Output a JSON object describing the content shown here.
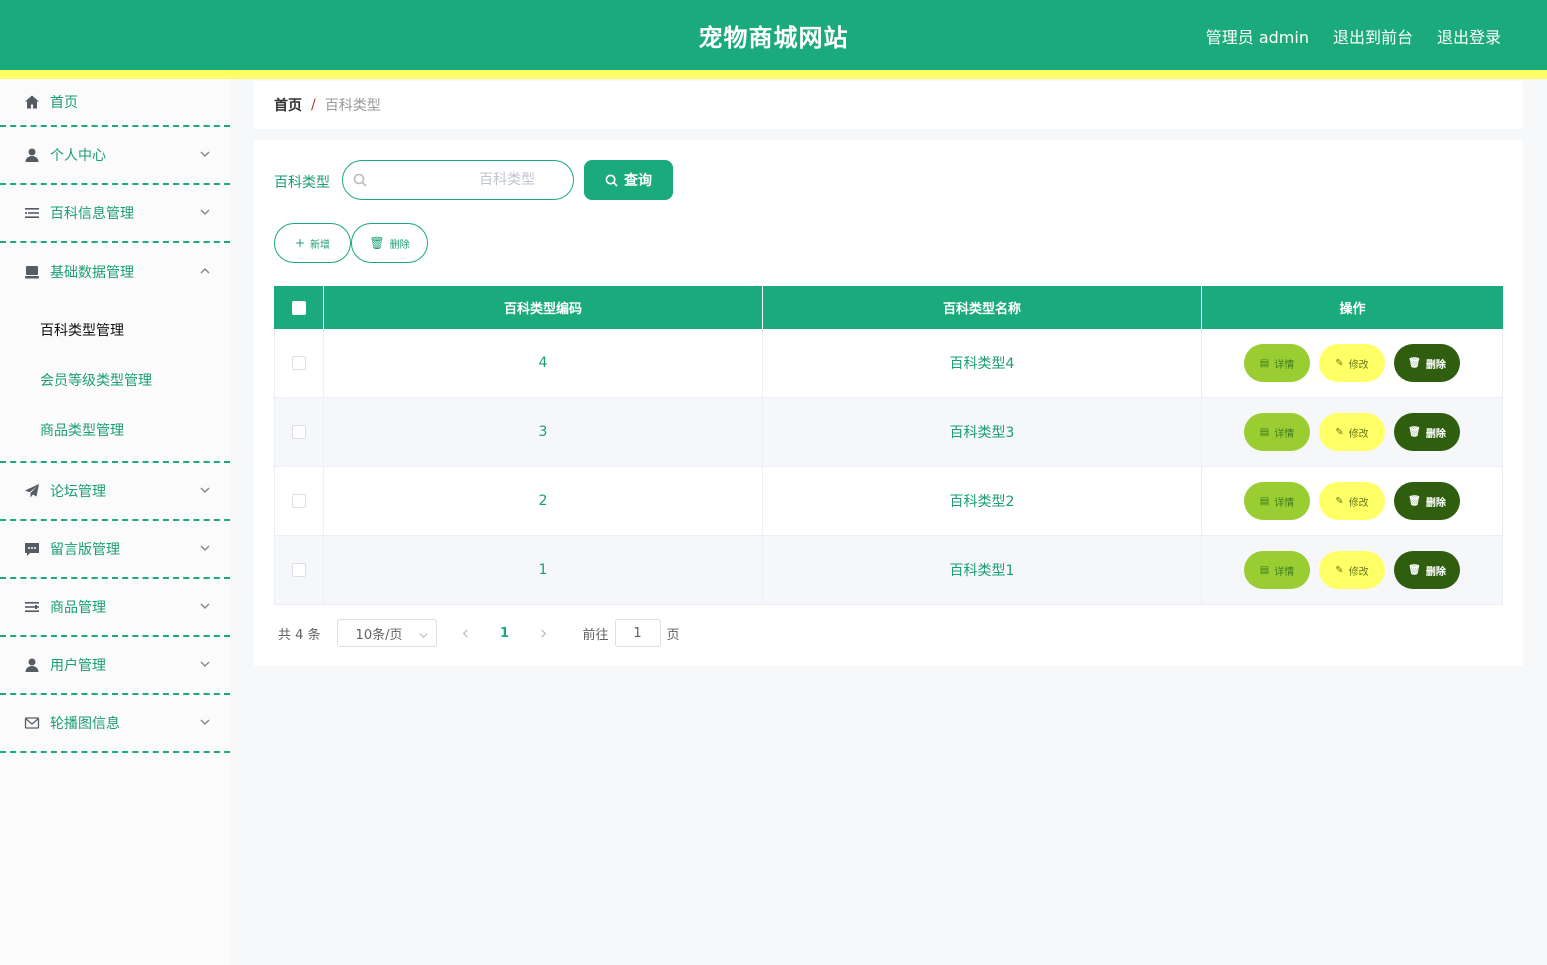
{
  "header": {
    "title": "宠物商城网站",
    "admin_label": "管理员 admin",
    "front_link": "退出到前台",
    "logout_link": "退出登录"
  },
  "colors": {
    "primary": "#1aaa7b",
    "stripe": "#ffff66",
    "detail_btn": "#9acd32",
    "edit_btn": "#ffff66",
    "delete_btn": "#2e5e0e"
  },
  "sidebar": {
    "home": "首页",
    "items": [
      {
        "label": "个人中心",
        "icon": "user-icon"
      },
      {
        "label": "百科信息管理",
        "icon": "list-icon"
      },
      {
        "label": "基础数据管理",
        "icon": "box-icon",
        "expanded": true
      },
      {
        "label": "论坛管理",
        "icon": "send-icon"
      },
      {
        "label": "留言版管理",
        "icon": "message-icon"
      },
      {
        "label": "商品管理",
        "icon": "menu-icon"
      },
      {
        "label": "用户管理",
        "icon": "user-icon"
      },
      {
        "label": "轮播图信息",
        "icon": "mail-icon"
      }
    ],
    "submenu": [
      {
        "label": "百科类型管理",
        "active": true
      },
      {
        "label": "会员等级类型管理",
        "active": false
      },
      {
        "label": "商品类型管理",
        "active": false
      }
    ]
  },
  "breadcrumb": {
    "home": "首页",
    "separator": "/",
    "current": "百科类型"
  },
  "search": {
    "label": "百科类型",
    "placeholder": "百科类型",
    "query_button": "查询"
  },
  "actions": {
    "add": "新增",
    "delete": "删除"
  },
  "table": {
    "columns": [
      "百科类型编码",
      "百科类型名称",
      "操作"
    ],
    "rows": [
      {
        "code": "4",
        "name": "百科类型4"
      },
      {
        "code": "3",
        "name": "百科类型3"
      },
      {
        "code": "2",
        "name": "百科类型2"
      },
      {
        "code": "1",
        "name": "百科类型1"
      }
    ],
    "row_actions": {
      "detail": "详情",
      "edit": "修改",
      "delete": "删除"
    }
  },
  "pagination": {
    "total": "共 4 条",
    "page_size": "10条/页",
    "current_page": "1",
    "goto_label": "前往",
    "goto_value": "1",
    "page_label": "页"
  }
}
